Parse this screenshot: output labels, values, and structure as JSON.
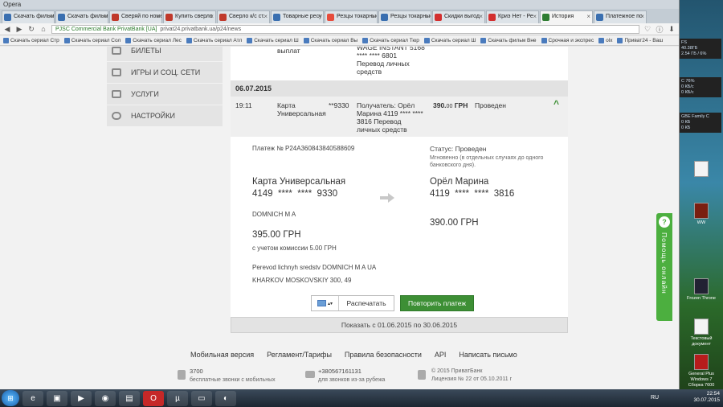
{
  "window_title": "Opera",
  "tabs": [
    {
      "label": "Скачать фильм",
      "color": "#3a6fb0"
    },
    {
      "label": "Скачать фильм",
      "color": "#3a6fb0"
    },
    {
      "label": "Сверяй по номеру",
      "color": "#c0392b"
    },
    {
      "label": "Купить сверло",
      "color": "#c0392b"
    },
    {
      "label": "Сверло к/с ст.",
      "color": "#c0392b"
    },
    {
      "label": "Товарные ресу",
      "color": "#3a6fb0"
    },
    {
      "label": "Резцы токарные",
      "color": "#e74c3c"
    },
    {
      "label": "Резцы токарные",
      "color": "#3a6fb0"
    },
    {
      "label": "Скидки выгод",
      "color": "#d32f2f"
    },
    {
      "label": "Криэ Нет - Ре",
      "color": "#d32f2f"
    },
    {
      "label": "История",
      "color": "#2e7d32"
    },
    {
      "label": "Платежное по",
      "color": "#3a6fb0"
    }
  ],
  "url": {
    "secure_label": "PJSC Commercial Bank PrivatBank [UA]",
    "address": "privat24.privatbank.ua/p24/news"
  },
  "bookmarks": [
    "Скачать сериал Стр",
    "Скачать сериал Сол",
    "Скачать сериал Лес",
    "Скачать сериал Атл",
    "Скачать сериал Ш",
    "Скачать сериал Вы",
    "Скачать сериал Тюр",
    "Скачать сериал Ш",
    "Скачать фильм Вне",
    "Срочная и экспрес",
    "olx",
    "Приват24 - Ваш"
  ],
  "menu": [
    "БИЛЕТЫ",
    "ИГРЫ И СОЦ. СЕТИ",
    "УСЛУГИ",
    "НАСТРОЙКИ"
  ],
  "prev_tx": {
    "type": "выплат",
    "details": "WAGE INSTANT 5168\n**** **** 6801\nПеревод личных\nсредств"
  },
  "date": "06.07.2015",
  "tx": {
    "time": "19:11",
    "card": "Карта\nУниверсальная",
    "card_mask": "**9330",
    "recipient": "Получатель: Орёл\nМарина 4119 **** ****\n3816 Перевод\nличных средств",
    "amount": "390.",
    "amount_cents": "00",
    "currency": "ГРН",
    "status": "Проведен"
  },
  "detail": {
    "payment_no": "Платеж № P24A360843840588609",
    "status": "Статус: Проведен",
    "status_note": "Мгновенно (в отдельных случаях до одного\nбанковского дня).",
    "from_card": "Карта Универсальная",
    "from_number": "4149  ****  ****  9330",
    "to_name": "Орёл Марина",
    "to_number": "4119  ****  ****  3816",
    "holder": "DOMNICH M A",
    "to_amount": "390.00 ГРН",
    "from_amount": "395.00 ГРН",
    "commission": "с учетом комиссии 5.00 ГРН",
    "purpose": "Perevod lichnyh sredstv DOMNICH M A UA",
    "address": "KHARKOV MOSKOVSKIY 300, 49",
    "print_label": "Распечатать",
    "repeat_label": "Повторить платеж"
  },
  "show_range": "Показать с 01.06.2015 по 30.06.2015",
  "footer": {
    "links": [
      "Мобильная версия",
      "Регламент/Тарифы",
      "Правила безопасности",
      "API",
      "Написать письмо"
    ],
    "phone_short": "3700",
    "phone_short_note": "бесплатные звонки с мобильных",
    "phone_long": "+380567161131",
    "phone_long_note": "для звонков из-за рубежа",
    "copyright": "© 2015 ПриватБанк",
    "license": "Лицензия № 22 от 05.10.2011 г"
  },
  "help_label": "Помощь онлайн",
  "desktop": {
    "gadget1": "FS\n40.38ГБ\n2.54 ГБ / 6%",
    "gadget2": "C 76%\n0 КБ/с\n0 КБ/с",
    "gadget3": "GBE Family C\n0 КБ\n0 КБ",
    "icons": [
      "WW",
      "Frozen Throne",
      "Текстовый документ",
      "General Plus Windows 7 Сборка 7600"
    ]
  },
  "taskbar": {
    "lang": "RU",
    "time": "22:54",
    "date": "30.07.2015"
  }
}
